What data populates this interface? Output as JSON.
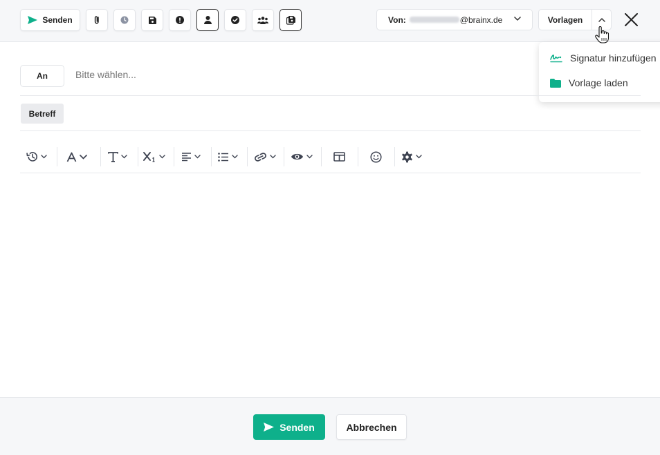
{
  "toolbar": {
    "send_label": "Senden",
    "icons": [
      "send-icon",
      "paperclip-icon",
      "clock-icon",
      "save-icon",
      "exclamation-icon",
      "person-icon",
      "check-circle-icon",
      "group-icon",
      "save-copy-icon"
    ]
  },
  "from": {
    "label": "Von:",
    "domain": "@brainx.de"
  },
  "templates": {
    "label": "Vorlagen",
    "menu": [
      {
        "label": "Signatur hinzufügen",
        "icon": "signature-icon"
      },
      {
        "label": "Vorlage laden",
        "icon": "folder-icon"
      }
    ]
  },
  "recipients": {
    "button_label": "An",
    "placeholder": "Bitte wählen..."
  },
  "subject": {
    "label": "Betreff"
  },
  "editor_toolbar": [
    "history-icon",
    "font-color-icon",
    "font-size-icon",
    "subscript-icon",
    "align-icon",
    "list-icon",
    "link-icon",
    "preview-icon",
    "table-icon",
    "emoji-icon",
    "settings-icon"
  ],
  "footer": {
    "send_label": "Senden",
    "cancel_label": "Abbrechen"
  },
  "colors": {
    "accent": "#0eb08b",
    "topbar_bg": "#f6f7f9",
    "icon_dark": "#222222",
    "icon_muted": "#8c93a3"
  }
}
